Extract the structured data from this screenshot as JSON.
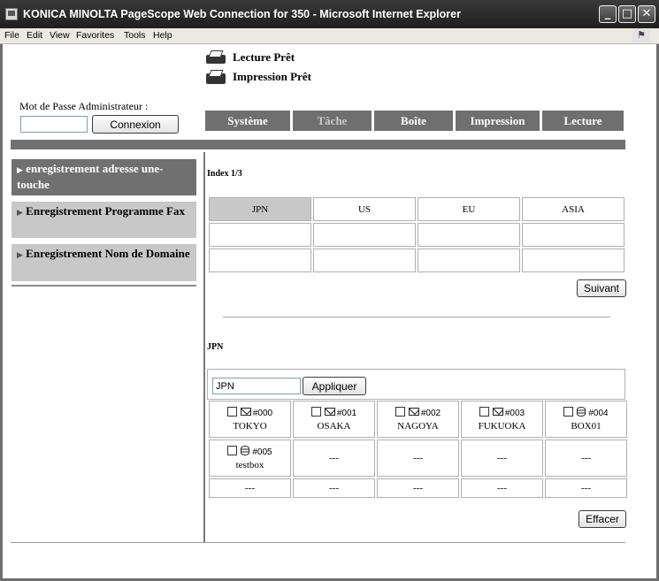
{
  "window": {
    "title": "KONICA MINOLTA PageScope Web Connection for 350 - Microsoft Internet Explorer",
    "controls": {
      "minimize": "_",
      "maximize": "□",
      "close": "✕"
    }
  },
  "menubar": [
    "File",
    "Edit",
    "View",
    "Favorites",
    "Tools",
    "Help"
  ],
  "status": {
    "scan_ready": "Lecture Prêt",
    "print_ready": "Impression Prêt"
  },
  "login": {
    "label": "Mot de Passe Administrateur :",
    "password_value": "",
    "button": "Connexion"
  },
  "tabs": [
    {
      "label": "Système",
      "active": false
    },
    {
      "label": "Tâche",
      "active": true
    },
    {
      "label": "Boîte",
      "active": false
    },
    {
      "label": "Impression",
      "active": false
    },
    {
      "label": "Lecture",
      "active": false
    }
  ],
  "sidebar": {
    "items": [
      {
        "label": "enregistrement adresse une-touche",
        "active": true
      },
      {
        "label": "Enregistrement Programme Fax",
        "active": false
      },
      {
        "label": "Enregistrement Nom de Domaine",
        "active": false
      }
    ]
  },
  "index": {
    "title": "Index 1/3",
    "regions": [
      "JPN",
      "US",
      "EU",
      "ASIA"
    ],
    "selected": "JPN",
    "next_button": "Suivant"
  },
  "entries": {
    "heading": "JPN",
    "filter_value": "JPN",
    "apply_button": "Appliquer",
    "rows": [
      [
        {
          "icon": "mail-icon",
          "number": "#000",
          "name": "TOKYO"
        },
        {
          "icon": "mail-icon",
          "number": "#001",
          "name": "OSAKA"
        },
        {
          "icon": "mail-icon",
          "number": "#002",
          "name": "NAGOYA"
        },
        {
          "icon": "mail-icon",
          "number": "#003",
          "name": "FUKUOKA"
        },
        {
          "icon": "box-icon",
          "number": "#004",
          "name": "BOX01"
        }
      ],
      [
        {
          "icon": "box-icon",
          "number": "#005",
          "name": "testbox"
        },
        {
          "empty": "---"
        },
        {
          "empty": "---"
        },
        {
          "empty": "---"
        },
        {
          "empty": "---"
        }
      ],
      [
        {
          "empty": "---"
        },
        {
          "empty": "---"
        },
        {
          "empty": "---"
        },
        {
          "empty": "---"
        },
        {
          "empty": "---"
        }
      ]
    ],
    "clear_button": "Effacer"
  }
}
